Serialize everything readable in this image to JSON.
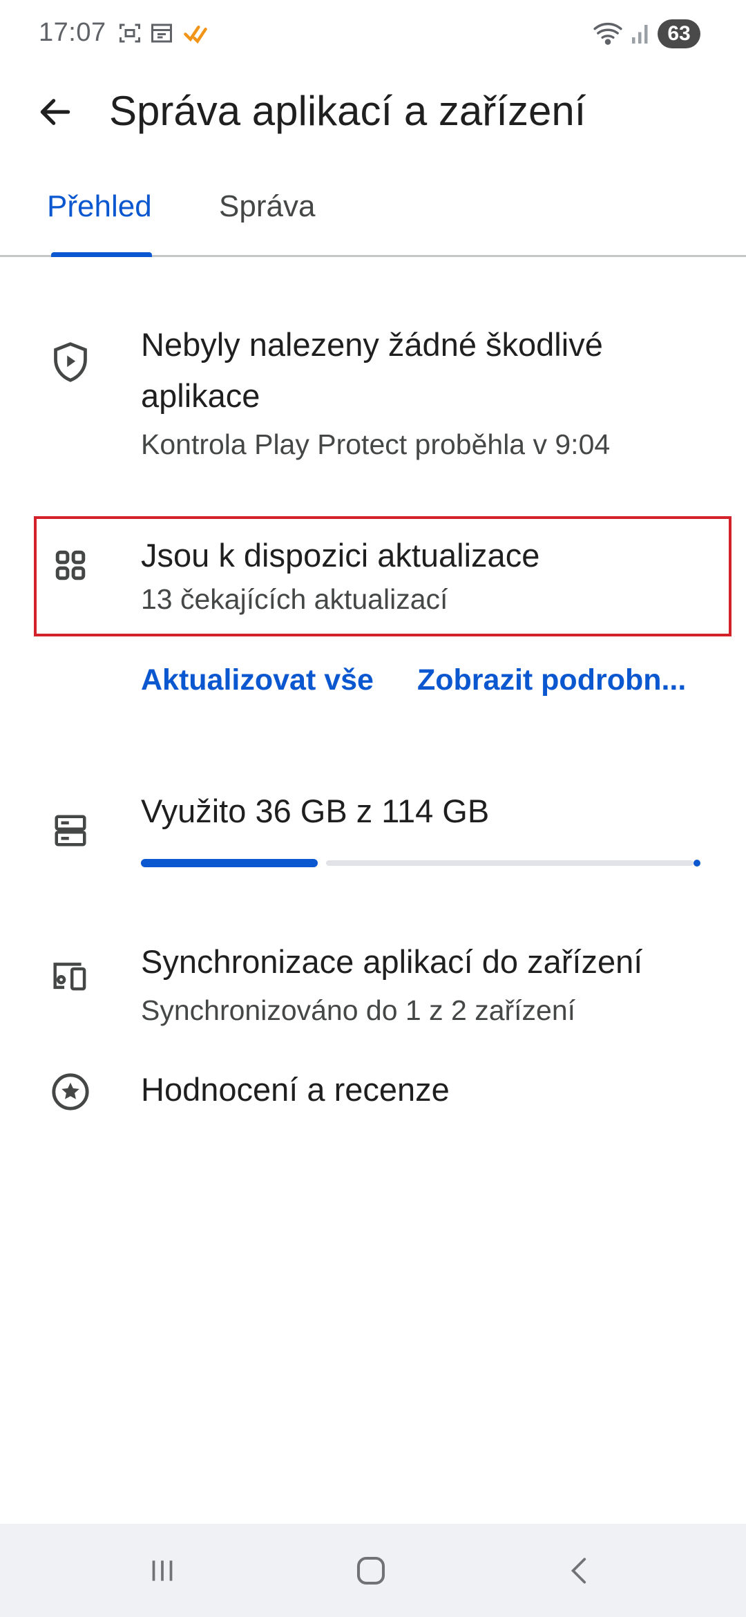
{
  "status_bar": {
    "time": "17:07",
    "battery": "63",
    "icons": [
      "screenshot-icon",
      "calendar-icon",
      "app-notification-icon",
      "wifi-icon",
      "signal-icon"
    ]
  },
  "app_bar": {
    "title": "Správa aplikací a zařízení",
    "back_icon": "arrow-back-icon"
  },
  "tabs": [
    {
      "label": "Přehled",
      "active": true
    },
    {
      "label": "Správa",
      "active": false
    }
  ],
  "play_protect": {
    "icon": "shield-play-icon",
    "title": "Nebyly nalezeny žádné škodlivé aplikace",
    "subtitle": "Kontrola Play Protect proběhla v 9:04"
  },
  "updates": {
    "icon": "apps-grid-icon",
    "title": "Jsou k dispozici aktualizace",
    "subtitle": "13 čekajících aktualizací",
    "update_all_label": "Aktualizovat vše",
    "details_label": "Zobrazit podrobn..."
  },
  "storage": {
    "icon": "storage-icon",
    "title": "Využito 36 GB z 114 GB",
    "used_fraction": 0.316
  },
  "sync": {
    "icon": "devices-icon",
    "title": "Synchronizace aplikací do zařízení",
    "subtitle": "Synchronizováno do 1 z 2 zařízení"
  },
  "ratings": {
    "icon": "star-circle-icon",
    "title": "Hodnocení a recenze"
  },
  "colors": {
    "accent": "#0b57d0",
    "highlight": "#d3222a"
  },
  "nav_bar": {
    "icons": [
      "recent-apps-icon",
      "home-icon",
      "nav-back-icon"
    ]
  }
}
